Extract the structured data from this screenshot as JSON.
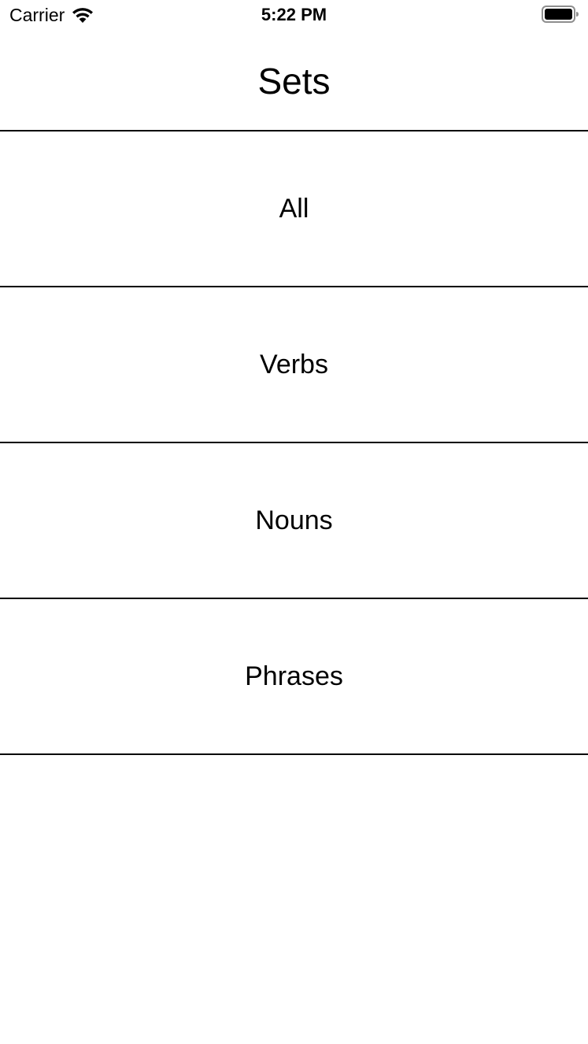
{
  "status_bar": {
    "carrier": "Carrier",
    "time": "5:22 PM",
    "wifi_icon": "wifi-icon",
    "battery_icon": "battery-full-icon"
  },
  "header": {
    "title": "Sets"
  },
  "sets": [
    {
      "label": "All"
    },
    {
      "label": "Verbs"
    },
    {
      "label": "Nouns"
    },
    {
      "label": "Phrases"
    }
  ],
  "colors": {
    "background": "#ffffff",
    "text": "#000000",
    "divider": "#000000"
  }
}
